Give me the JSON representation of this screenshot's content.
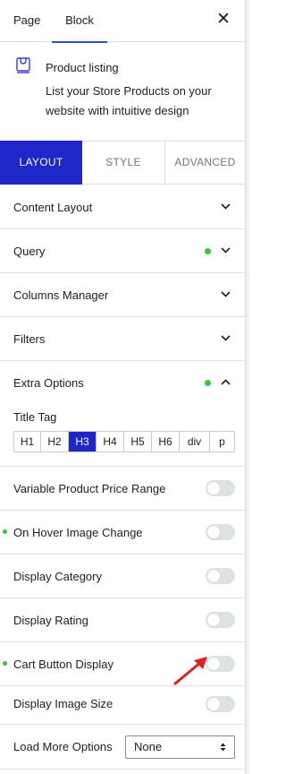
{
  "top_tabs": {
    "page": "Page",
    "block": "Block"
  },
  "close_symbol": "✕",
  "block": {
    "icon": "product-listing-icon",
    "title": "Product listing",
    "description": "List your Store Products on your website with intuitive design"
  },
  "mode_tabs": {
    "layout": "LAYOUT",
    "style": "STYLE",
    "advanced": "ADVANCED"
  },
  "sections": {
    "content_layout": "Content Layout",
    "query": "Query",
    "columns_manager": "Columns Manager",
    "filters": "Filters",
    "extra_options": "Extra Options"
  },
  "extra_options": {
    "title_tag_label": "Title Tag",
    "tags": [
      "H1",
      "H2",
      "H3",
      "H4",
      "H5",
      "H6",
      "div",
      "p"
    ],
    "active_tag": "H3",
    "options": [
      {
        "label": "Variable Product Price Range",
        "enabled": false,
        "modified": false
      },
      {
        "label": "On Hover Image Change",
        "enabled": false,
        "modified": true
      },
      {
        "label": "Display Category",
        "enabled": false,
        "modified": false
      },
      {
        "label": "Display Rating",
        "enabled": false,
        "modified": false
      },
      {
        "label": "Cart Button Display",
        "enabled": false,
        "modified": true
      },
      {
        "label": "Display Image Size",
        "enabled": false,
        "modified": false
      }
    ],
    "load_more_label": "Load More Options",
    "load_more_value": "None"
  },
  "colors": {
    "accent": "#1f27c9",
    "tab_underline": "#2a51c6",
    "modified_dot": "#2ecc2e",
    "toggle_off": "#dde2e2",
    "annotation_arrow": "#e02020"
  }
}
